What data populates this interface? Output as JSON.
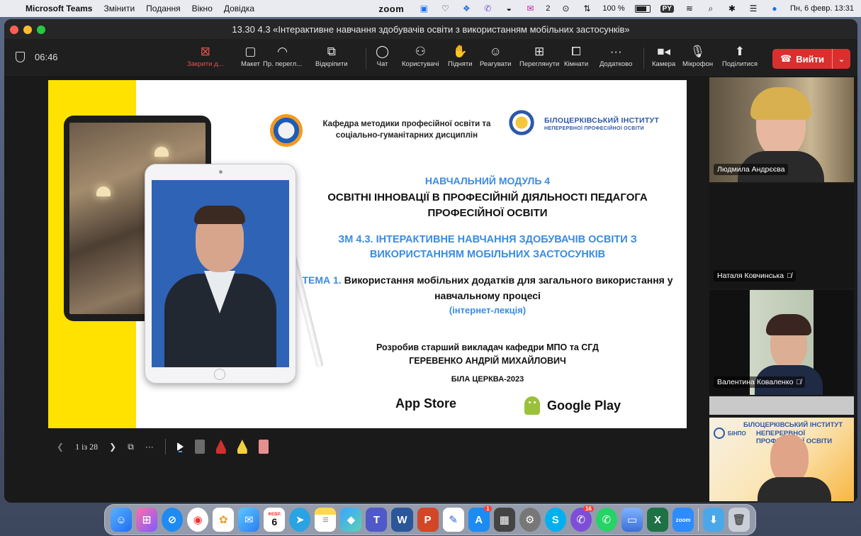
{
  "menubar": {
    "app_name": "Microsoft Teams",
    "menus": [
      "Змінити",
      "Подання",
      "Вікно",
      "Довідка"
    ],
    "zoom_label": "zoom",
    "mail_count": "2",
    "battery": "100 %",
    "input_source": "PY",
    "datetime": "Пн, 6 февр.  13:31"
  },
  "window": {
    "title": "13.30 4.3 «Інтерактивне навчання здобувачів освіти з використанням мобільних застосунків»"
  },
  "toolbar": {
    "timer": "06:46",
    "buttons": [
      {
        "label": "Закрити д...",
        "icon": "close-share-icon"
      },
      {
        "label": "Макет",
        "icon": "layout-icon"
      },
      {
        "label": "Пр. перегл...",
        "icon": "view-icon"
      },
      {
        "label": "Відкріпити",
        "icon": "pop-out-icon"
      },
      {
        "label": "Чат",
        "icon": "chat-icon"
      },
      {
        "label": "Користувачі",
        "icon": "people-icon"
      },
      {
        "label": "Підняти",
        "icon": "raise-hand-icon"
      },
      {
        "label": "Реагувати",
        "icon": "react-icon"
      },
      {
        "label": "Переглянути",
        "icon": "view-grid-icon"
      },
      {
        "label": "Кімнати",
        "icon": "rooms-icon"
      },
      {
        "label": "Додатково",
        "icon": "more-icon"
      },
      {
        "label": "Камера",
        "icon": "camera-icon"
      },
      {
        "label": "Мікрофон",
        "icon": "mic-icon"
      },
      {
        "label": "Поділитися",
        "icon": "share-icon"
      }
    ],
    "leave_label": "Вийти"
  },
  "slide": {
    "department": "Кафедра методики професійної освіти та соціально-гуманітарних дисциплін",
    "institute_line1": "БІЛОЦЕРКІВСЬКИЙ ІНСТИТУТ",
    "institute_line2": "НЕПЕРЕРВНОЇ ПРОФЕСІЙНОЇ ОСВІТИ",
    "module_title": "НАВЧАЛЬНИЙ МОДУЛЬ 4",
    "module_subtitle": "ОСВІТНІ ІННОВАЦІЇ В ПРОФЕСІЙНІЙ ДІЯЛЬНОСТІ ПЕДАГОГА ПРОФЕСІЙНОЇ ОСВІТИ",
    "zm_title": "ЗМ 4.3. ІНТЕРАКТИВНЕ НАВЧАННЯ ЗДОБУВАЧІВ ОСВІТИ З ВИКОРИСТАННЯМ МОБІЛЬНИХ ЗАСТОСУНКІВ",
    "tema_prefix": "ТЕМА 1.",
    "tema_text": "Використання мобільних додатків для загального використання у навчальному процесі",
    "lecture_type": "(інтернет-лекція)",
    "author_line1": "Розробив старший викладач кафедри МПО та СГД",
    "author_line2": "ГЕРЕВЕНКО АНДРІЙ МИХАЙЛОВИЧ",
    "city": "БІЛА ЦЕРКВА-2023",
    "app_store": "App Store",
    "google_play": "Google Play"
  },
  "slide_controls": {
    "page_indicator": "1 із 28"
  },
  "participants": [
    {
      "name": "Людмила Андрєєва",
      "muted": false
    },
    {
      "name": "Наталя Ковчинська",
      "muted": true
    },
    {
      "name": "Валентина Коваленко",
      "muted": true
    },
    {
      "name": "",
      "muted": false
    }
  ],
  "participant4_slide": {
    "brand": "БІНПО",
    "title1": "БІЛОЦЕРКІВСЬКИЙ ІНСТИТУТ",
    "title2": "НЕПЕРЕРВНОЇ ПРОФЕСІЙНОЇ ОСВІТИ"
  },
  "dock": {
    "calendar_month": "ФЕВР.",
    "calendar_day": "6",
    "appstore_badge": "1",
    "viber_badge": "16",
    "zoom_label": "zoom"
  }
}
